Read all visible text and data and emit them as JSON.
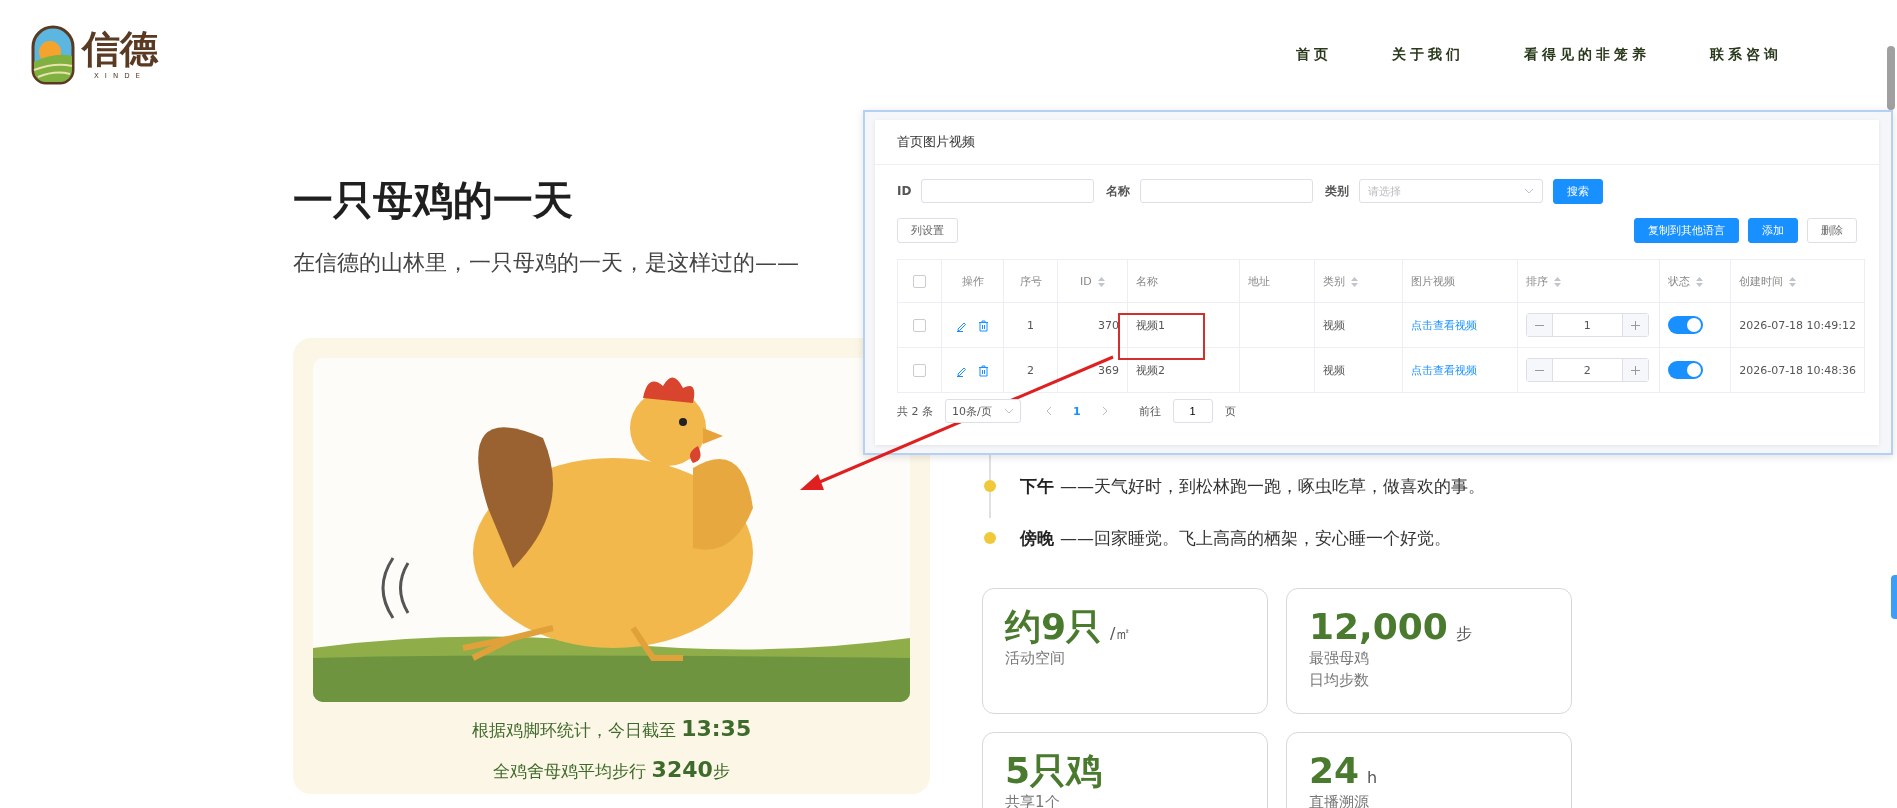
{
  "header": {
    "logo": {
      "name": "信德",
      "subtitle": "XINDE"
    },
    "nav": [
      {
        "label": "首页"
      },
      {
        "label": "关于我们"
      },
      {
        "label": "看得见的非笼养"
      },
      {
        "label": "联系咨询"
      }
    ]
  },
  "hero": {
    "title": "一只母鸡的一天",
    "subtitle": "在信德的山林里，一只母鸡的一天，是这样过的——"
  },
  "feature_card": {
    "captions": [
      "根据鸡脚环统计，今日截至 **13:35**",
      "全鸡舍母鸡平均步行 **3240**步"
    ]
  },
  "timeline": [
    {
      "time": "下午",
      "text": "——天气好时，到松林跑一跑，啄虫吃草，做喜欢的事。"
    },
    {
      "time": "傍晚",
      "text": "——回家睡觉。飞上高高的栖架，安心睡一个好觉。"
    }
  ],
  "stats": [
    {
      "value": "约9只",
      "unit": "/㎡",
      "labels": [
        "活动空间"
      ]
    },
    {
      "value": "12,000",
      "unit": "步",
      "labels": [
        "最强母鸡",
        "日均步数"
      ]
    },
    {
      "value": "5只鸡",
      "labels": [
        "共享1个"
      ]
    },
    {
      "value": "24",
      "unit": "h",
      "labels": [
        "直播溯源"
      ]
    }
  ],
  "admin_panel": {
    "title": "首页图片视频",
    "filters": [
      {
        "kind": "input",
        "label": "ID"
      },
      {
        "kind": "input",
        "label": "名称"
      },
      {
        "kind": "select",
        "label": "类别",
        "placeholder": "请选择"
      }
    ],
    "search_button": "搜索",
    "left_buttons": [
      {
        "label": "列设置",
        "primary": false
      }
    ],
    "right_buttons": [
      {
        "label": "复制到其他语言",
        "primary": true
      },
      {
        "label": "添加",
        "primary": true
      },
      {
        "label": "删除",
        "primary": false
      }
    ],
    "columns": [
      {
        "kind": "check",
        "checked": false
      },
      {
        "label": "操作",
        "sortable": false
      },
      {
        "label": "序号",
        "sortable": false
      },
      {
        "label": "ID",
        "sortable": true
      },
      {
        "label": "名称",
        "sortable": false
      },
      {
        "label": "地址",
        "sortable": false
      },
      {
        "label": "类别",
        "sortable": true
      },
      {
        "label": "图片视频",
        "sortable": false
      },
      {
        "label": "排序",
        "sortable": true
      },
      {
        "label": "状态",
        "sortable": true
      },
      {
        "label": "创建时间",
        "sortable": true
      }
    ],
    "rows": [
      {
        "checked": false,
        "seq": "1",
        "id": "370",
        "name": "视频1",
        "category": "视频",
        "media": "点击查看视频",
        "order": "1",
        "on": true,
        "created": "2026-07-18 10:49:12"
      },
      {
        "checked": false,
        "seq": "2",
        "id": "369",
        "name": "视频2",
        "category": "视频",
        "media": "点击查看视频",
        "order": "2",
        "on": true,
        "created": "2026-07-18 10:48:36"
      }
    ],
    "pagination": {
      "total": "共 2 条",
      "page_size": "10条/页",
      "pages": [
        {
          "label": "1",
          "selected": true
        }
      ],
      "goto_label": "前往",
      "goto_value": "1",
      "goto_suffix": "页"
    }
  }
}
